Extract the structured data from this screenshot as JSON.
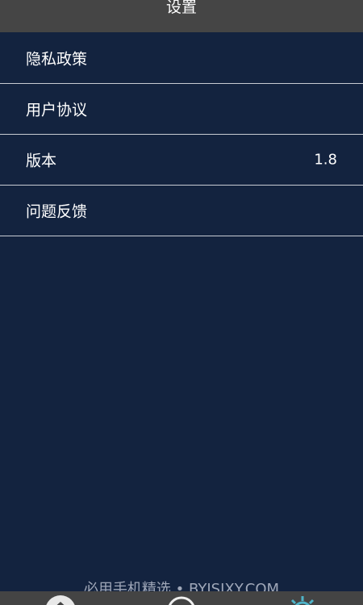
{
  "header": {
    "title": "设置"
  },
  "settings": {
    "items": [
      {
        "label": "隐私政策",
        "value": ""
      },
      {
        "label": "用户协议",
        "value": ""
      },
      {
        "label": "版本",
        "value": "1.8"
      },
      {
        "label": "问题反馈",
        "value": ""
      }
    ]
  },
  "watermark": {
    "text": "必用手机精选 • BYJSJXY.COM"
  },
  "tabbar": {
    "tabs": [
      {
        "icon": "home-icon"
      },
      {
        "icon": "compass-icon"
      },
      {
        "icon": "gear-icon"
      }
    ]
  },
  "colors": {
    "background": "#13233f",
    "header": "#454545",
    "divider": "#c8ccd3",
    "text": "#ffffff",
    "watermark": "#9fa7b8",
    "tab_active": "#4fb3c8"
  }
}
